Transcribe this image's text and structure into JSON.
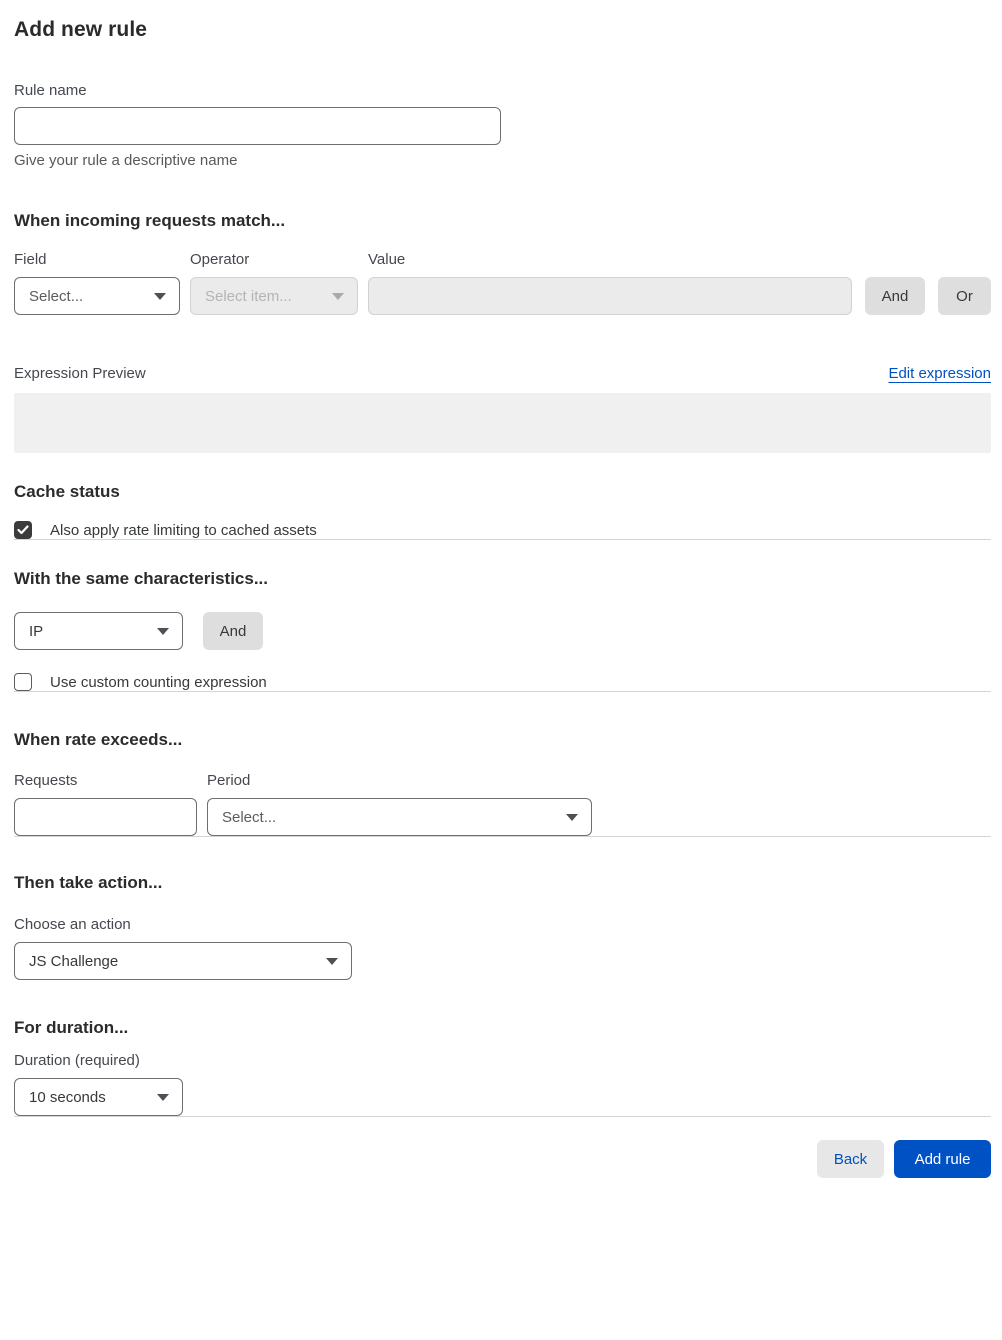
{
  "page": {
    "title": "Add new rule"
  },
  "rule_name": {
    "label": "Rule name",
    "value": "",
    "helper": "Give your rule a descriptive name"
  },
  "match": {
    "heading": "When incoming requests match...",
    "field": {
      "label": "Field",
      "selected": "Select..."
    },
    "operator": {
      "label": "Operator",
      "selected": "Select item...",
      "disabled": true
    },
    "value": {
      "label": "Value",
      "value": "",
      "disabled": true
    },
    "and_label": "And",
    "or_label": "Or"
  },
  "expression": {
    "label": "Expression Preview",
    "edit_link": "Edit expression",
    "preview_value": ""
  },
  "cache": {
    "heading": "Cache status",
    "checkbox_label": "Also apply rate limiting to cached assets",
    "checked": true
  },
  "characteristics": {
    "heading": "With the same characteristics...",
    "selected": "IP",
    "and_label": "And",
    "checkbox_label": "Use custom counting expression",
    "checked": false
  },
  "rate": {
    "heading": "When rate exceeds...",
    "requests_label": "Requests",
    "requests_value": "",
    "period_label": "Period",
    "period_selected": "Select..."
  },
  "action": {
    "heading": "Then take action...",
    "label": "Choose an action",
    "selected": "JS Challenge"
  },
  "duration": {
    "heading": "For duration...",
    "label": "Duration (required)",
    "selected": "10 seconds"
  },
  "footer": {
    "back_label": "Back",
    "add_label": "Add rule"
  },
  "colors": {
    "accent_blue": "#0051c3",
    "checkbox_checked": "#3b3b3b",
    "disabled_bg": "#ebebeb",
    "divider": "#d5d5d5"
  }
}
